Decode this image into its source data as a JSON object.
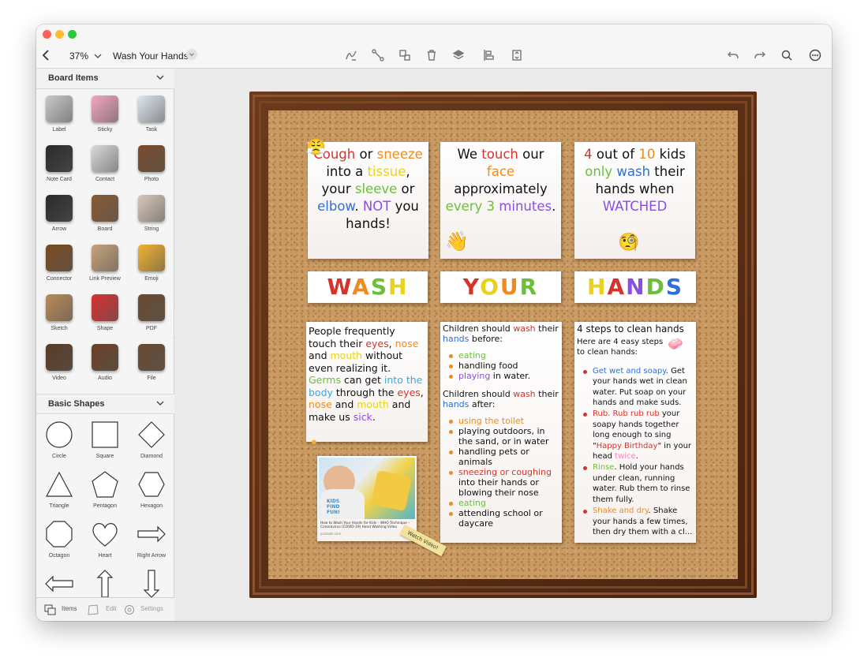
{
  "window": {
    "zoom": "37%",
    "doc_title": "Wash Your Hands"
  },
  "sidebar": {
    "board_items_title": "Board Items",
    "board_items": [
      {
        "label": "Label",
        "icon": "label-icon",
        "color": "#c9c9c9"
      },
      {
        "label": "Sticky",
        "icon": "sticky-icon",
        "color": "#f3a7c2"
      },
      {
        "label": "Task",
        "icon": "task-icon",
        "color": "#dfe6ee"
      },
      {
        "label": "Note Card",
        "icon": "note-card-icon",
        "color": "#2a2a2a"
      },
      {
        "label": "Contact",
        "icon": "contact-icon",
        "color": "#d9d9d9"
      },
      {
        "label": "Photo",
        "icon": "photo-icon",
        "color": "#7a4a2a"
      },
      {
        "label": "Arrow",
        "icon": "arrow-icon",
        "color": "#2a2a2a"
      },
      {
        "label": "Board",
        "icon": "board-icon",
        "color": "#8a5a32"
      },
      {
        "label": "String",
        "icon": "string-icon",
        "color": "#d8c8b8"
      },
      {
        "label": "Connector",
        "icon": "connector-icon",
        "color": "#7a4a20"
      },
      {
        "label": "Link Preview",
        "icon": "link-preview-icon",
        "color": "#c8a27a"
      },
      {
        "label": "Emoji",
        "icon": "emoji-icon",
        "color": "#f2b130"
      },
      {
        "label": "Sketch",
        "icon": "sketch-icon",
        "color": "#b98b56"
      },
      {
        "label": "Shape",
        "icon": "shape-icon",
        "color": "#d83030"
      },
      {
        "label": "PDF",
        "icon": "pdf-icon",
        "color": "#6a4a30"
      },
      {
        "label": "Video",
        "icon": "video-icon",
        "color": "#5a3a24"
      },
      {
        "label": "Audio",
        "icon": "audio-icon",
        "color": "#6a4024"
      },
      {
        "label": "File",
        "icon": "file-icon",
        "color": "#6a4a30"
      }
    ],
    "basic_shapes_title": "Basic Shapes",
    "basic_shapes": [
      {
        "label": "Circle",
        "icon": "circle-icon"
      },
      {
        "label": "Square",
        "icon": "square-icon"
      },
      {
        "label": "Diamond",
        "icon": "diamond-icon"
      },
      {
        "label": "Triangle",
        "icon": "triangle-icon"
      },
      {
        "label": "Pentagon",
        "icon": "pentagon-icon"
      },
      {
        "label": "Hexagon",
        "icon": "hexagon-icon"
      },
      {
        "label": "Octagon",
        "icon": "octagon-icon"
      },
      {
        "label": "Heart",
        "icon": "heart-icon"
      },
      {
        "label": "Right Arrow",
        "icon": "right-arrow-icon"
      },
      {
        "label": "",
        "icon": "left-arrow-icon"
      },
      {
        "label": "",
        "icon": "up-arrow-icon"
      },
      {
        "label": "",
        "icon": "down-arrow-icon"
      }
    ],
    "footer": {
      "items": "Items",
      "edit": "Edit",
      "settings": "Settings"
    }
  },
  "board": {
    "note1": [
      {
        "t": "Cough",
        "c": "c-red"
      },
      {
        "t": " or ",
        "c": "c-blk"
      },
      {
        "t": "sneeze",
        "c": "c-org"
      },
      {
        "t": " into a ",
        "c": "c-blk"
      },
      {
        "t": "tissue",
        "c": "c-yel"
      },
      {
        "t": ", your ",
        "c": "c-blk"
      },
      {
        "t": "sleeve",
        "c": "c-grn"
      },
      {
        "t": " or ",
        "c": "c-blk"
      },
      {
        "t": "elbow",
        "c": "c-blu"
      },
      {
        "t": ".  ",
        "c": "c-blk"
      },
      {
        "t": "NOT",
        "c": "c-pur"
      },
      {
        "t": " you hands!",
        "c": "c-blk"
      }
    ],
    "note2": [
      {
        "t": "We ",
        "c": "c-blk"
      },
      {
        "t": "touch",
        "c": "c-red"
      },
      {
        "t": " our ",
        "c": "c-blk"
      },
      {
        "t": "face",
        "c": "c-org"
      },
      {
        "t": " approximately ",
        "c": "c-blk"
      },
      {
        "t": "every 3",
        "c": "c-grn"
      },
      {
        "t": " ",
        "c": "c-blk"
      },
      {
        "t": "minutes",
        "c": "c-pur"
      },
      {
        "t": ".",
        "c": "c-blk"
      }
    ],
    "note3": [
      {
        "t": "4",
        "c": "c-red"
      },
      {
        "t": " out of ",
        "c": "c-blk"
      },
      {
        "t": "10",
        "c": "c-org"
      },
      {
        "t": " kids ",
        "c": "c-blk"
      },
      {
        "t": "only",
        "c": "c-grn"
      },
      {
        "t": " ",
        "c": "c-blk"
      },
      {
        "t": "wash",
        "c": "c-blu"
      },
      {
        "t": " their hands when ",
        "c": "c-blk"
      },
      {
        "t": "WATCHED",
        "c": "c-pur"
      }
    ],
    "word1": [
      {
        "t": "W",
        "c": "c-red"
      },
      {
        "t": "A",
        "c": "c-org"
      },
      {
        "t": "S",
        "c": "c-grn"
      },
      {
        "t": "H",
        "c": "c-yel"
      }
    ],
    "word2": [
      {
        "t": "Y",
        "c": "c-red"
      },
      {
        "t": "O",
        "c": "c-yel"
      },
      {
        "t": "U",
        "c": "c-org"
      },
      {
        "t": "R",
        "c": "c-grn"
      }
    ],
    "word3": [
      {
        "t": "H",
        "c": "c-yel"
      },
      {
        "t": "A",
        "c": "c-red"
      },
      {
        "t": "N",
        "c": "c-pur"
      },
      {
        "t": "D",
        "c": "c-grn"
      },
      {
        "t": "S",
        "c": "c-blu"
      }
    ],
    "note4": [
      {
        "t": "People frequently touch their ",
        "c": "c-blk"
      },
      {
        "t": "eyes",
        "c": "c-red"
      },
      {
        "t": ", ",
        "c": "c-blk"
      },
      {
        "t": "nose",
        "c": "c-org"
      },
      {
        "t": " and ",
        "c": "c-blk"
      },
      {
        "t": "mouth",
        "c": "c-yel"
      },
      {
        "t": " without even realizing it. ",
        "c": "c-blk"
      },
      {
        "t": "Germs",
        "c": "c-grn"
      },
      {
        "t": " can get ",
        "c": "c-blk"
      },
      {
        "t": "into the body",
        "c": "c-cyan"
      },
      {
        "t": " through the ",
        "c": "c-blk"
      },
      {
        "t": "eyes",
        "c": "c-red"
      },
      {
        "t": ", ",
        "c": "c-blk"
      },
      {
        "t": "nose",
        "c": "c-org"
      },
      {
        "t": " and ",
        "c": "c-blk"
      },
      {
        "t": "mouth",
        "c": "c-yel"
      },
      {
        "t": " and make us ",
        "c": "c-blk"
      },
      {
        "t": "sick",
        "c": "c-pur"
      },
      {
        "t": ".",
        "c": "c-blk"
      }
    ],
    "before_heading": [
      {
        "t": "Children should ",
        "c": "c-blk"
      },
      {
        "t": "wash",
        "c": "c-red"
      },
      {
        "t": " their ",
        "c": "c-blk"
      },
      {
        "t": "hands",
        "c": "c-blu"
      },
      {
        "t": " before:",
        "c": "c-blk"
      }
    ],
    "before_list": [
      [
        {
          "t": "eating",
          "c": "c-grn"
        }
      ],
      [
        {
          "t": "handling food",
          "c": "c-blk"
        }
      ],
      [
        {
          "t": "playing",
          "c": "c-pur"
        },
        {
          "t": " in water.",
          "c": "c-blk"
        }
      ]
    ],
    "after_heading": [
      {
        "t": "Children should ",
        "c": "c-blk"
      },
      {
        "t": "wash",
        "c": "c-red"
      },
      {
        "t": " their ",
        "c": "c-blk"
      },
      {
        "t": "hands",
        "c": "c-blu"
      },
      {
        "t": " after:",
        "c": "c-blk"
      }
    ],
    "after_list": [
      [
        {
          "t": "using the toilet",
          "c": "c-org"
        }
      ],
      [
        {
          "t": "playing outdoors, in the sand, or in water",
          "c": "c-blk"
        }
      ],
      [
        {
          "t": "handling pets or animals",
          "c": "c-blk"
        }
      ],
      [
        {
          "t": "sneezing or coughing",
          "c": "c-red"
        },
        {
          "t": " into their hands or blowing their nose",
          "c": "c-blk"
        }
      ],
      [
        {
          "t": "eating",
          "c": "c-grn"
        }
      ],
      [
        {
          "t": "attending school or daycare",
          "c": "c-blk"
        }
      ]
    ],
    "steps_title": "4 steps to clean hands",
    "steps_intro": "Here are 4 easy steps to clean hands:",
    "steps": [
      [
        {
          "t": "Get wet and soapy",
          "c": "c-blu"
        },
        {
          "t": ". Get your hands wet in clean water. Put soap on your hands and make suds.",
          "c": "c-blk"
        }
      ],
      [
        {
          "t": "Rub. Rub rub rub",
          "c": "c-red"
        },
        {
          "t": " your soapy hands together long enough to sing \"",
          "c": "c-blk"
        },
        {
          "t": "Happy Birthday",
          "c": "c-red"
        },
        {
          "t": "\" in your head ",
          "c": "c-blk"
        },
        {
          "t": "twice",
          "c": "c-pink"
        },
        {
          "t": ".",
          "c": "c-blk"
        }
      ],
      [
        {
          "t": "Rinse",
          "c": "c-grn"
        },
        {
          "t": ". Hold your hands under clean, running water. Rub them to rinse them fully.",
          "c": "c-blk"
        }
      ],
      [
        {
          "t": "Shake and dry",
          "c": "c-org"
        },
        {
          "t": ". Shake your hands a few times, then dry them with a cl...",
          "c": "c-blk"
        }
      ]
    ],
    "video_caption": "How to Wash Your Hands for Kids – WHO Technique – Coronavirus (COVID-19) Hand Washing Video",
    "video_source": "youtube.com",
    "video_thumb_text": "KIDS FIND FUN!",
    "watch_tag": "Watch Video!"
  }
}
